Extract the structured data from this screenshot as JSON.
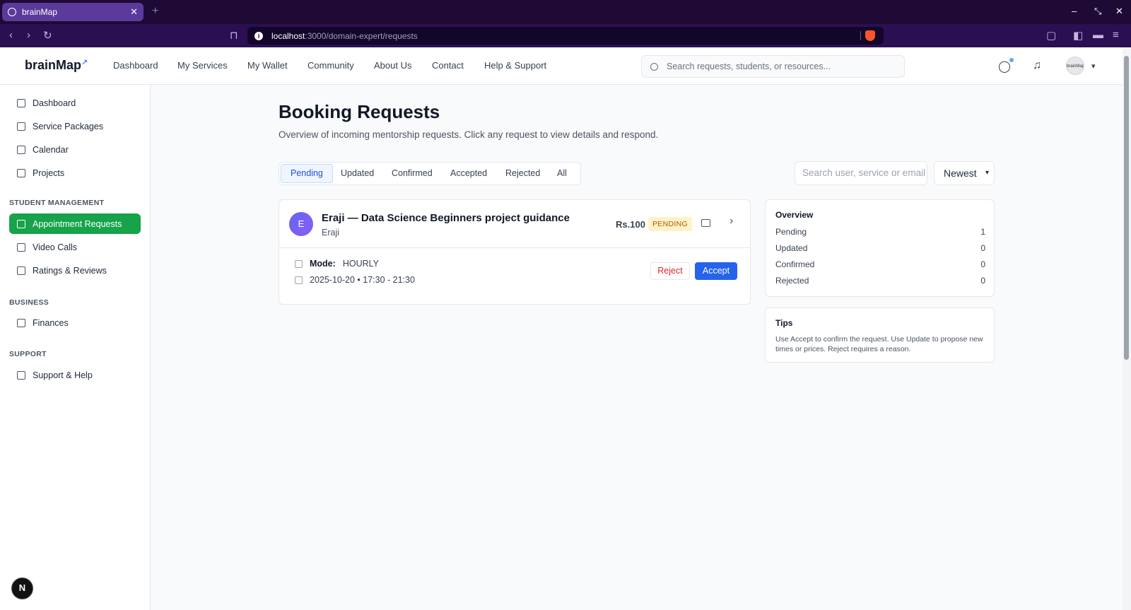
{
  "browser": {
    "tab_title": "brainMap",
    "url_host": "localhost",
    "url_path": ":3000/domain-expert/requests"
  },
  "header": {
    "logo": "brainMap",
    "nav": [
      "Dashboard",
      "My Services",
      "My Wallet",
      "Community",
      "About Us",
      "Contact",
      "Help & Support"
    ],
    "search_placeholder": "Search requests, students, or resources...",
    "avatar_text": "brainMap"
  },
  "sidebar": {
    "items_top": [
      "Dashboard",
      "Service Packages",
      "Calendar",
      "Projects"
    ],
    "sections": [
      {
        "heading": "STUDENT MANAGEMENT",
        "items": [
          "Appointment Requests",
          "Video Calls",
          "Ratings & Reviews"
        ]
      },
      {
        "heading": "BUSINESS",
        "items": [
          "Finances"
        ]
      },
      {
        "heading": "SUPPORT",
        "items": [
          "Support & Help"
        ]
      }
    ],
    "active": "Appointment Requests",
    "badge": "N"
  },
  "main": {
    "title": "Booking Requests",
    "subtitle": "Overview of incoming mentorship requests. Click any request to view details and respond.",
    "filter_tabs": [
      "Pending",
      "Updated",
      "Confirmed",
      "Accepted",
      "Rejected",
      "All"
    ],
    "active_tab": "Pending",
    "search_placeholder": "Search user, service or email",
    "sort_value": "Newest"
  },
  "request": {
    "avatar_letter": "E",
    "title": "Eraji — Data Science Beginners project guidance",
    "name": "Eraji",
    "price": "Rs.100",
    "status": "PENDING",
    "mode_label": "Mode:",
    "mode_value": "HOURLY",
    "schedule": "2025-10-20 • 17:30 - 21:30",
    "reject_label": "Reject",
    "accept_label": "Accept"
  },
  "overview": {
    "title": "Overview",
    "rows": [
      {
        "label": "Pending",
        "value": "1"
      },
      {
        "label": "Updated",
        "value": "0"
      },
      {
        "label": "Confirmed",
        "value": "0"
      },
      {
        "label": "Rejected",
        "value": "0"
      }
    ]
  },
  "tips": {
    "title": "Tips",
    "text": "Use Accept to confirm the request. Use Update to propose new times or prices. Reject requires a reason."
  },
  "colors": {
    "active_green": "#16a34a",
    "accept_blue": "#2563eb",
    "reject_red": "#dc2626",
    "pending_bg": "#fef3c7",
    "browser_bg": "#1e0a35"
  }
}
